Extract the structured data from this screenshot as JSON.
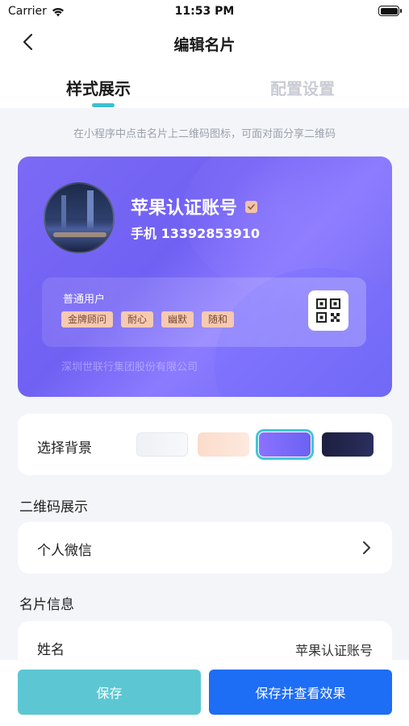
{
  "status_bar": {
    "carrier": "Carrier",
    "time": "11:53 PM"
  },
  "nav": {
    "title": "编辑名片"
  },
  "tabs": [
    {
      "label": "样式展示",
      "active": true
    },
    {
      "label": "配置设置",
      "active": false
    }
  ],
  "hint": "在小程序中点击名片上二维码图标，可面对面分享二维码",
  "card": {
    "name": "苹果认证账号",
    "phone": "手机 13392853910",
    "role": "普通用户",
    "tags": [
      "金牌顾问",
      "耐心",
      "幽默",
      "随和"
    ],
    "company": "深圳世联行集团股份有限公司",
    "accent_colors": {
      "card": "#7b6af5",
      "tag_bg": "#f5c9b2"
    }
  },
  "background_selector": {
    "label": "选择背景",
    "options": [
      "light-gray",
      "peach",
      "purple",
      "navy"
    ],
    "selected": "purple"
  },
  "qr_section": {
    "title": "二维码展示",
    "row_label": "个人微信"
  },
  "info_section": {
    "title": "名片信息",
    "name_label": "姓名",
    "name_value": "苹果认证账号"
  },
  "buttons": {
    "save": "保存",
    "save_and_view": "保存并查看效果"
  },
  "colors": {
    "primary_blue": "#1e6df5",
    "teal": "#5cc7d2",
    "indicator": "#3dbfd0"
  }
}
